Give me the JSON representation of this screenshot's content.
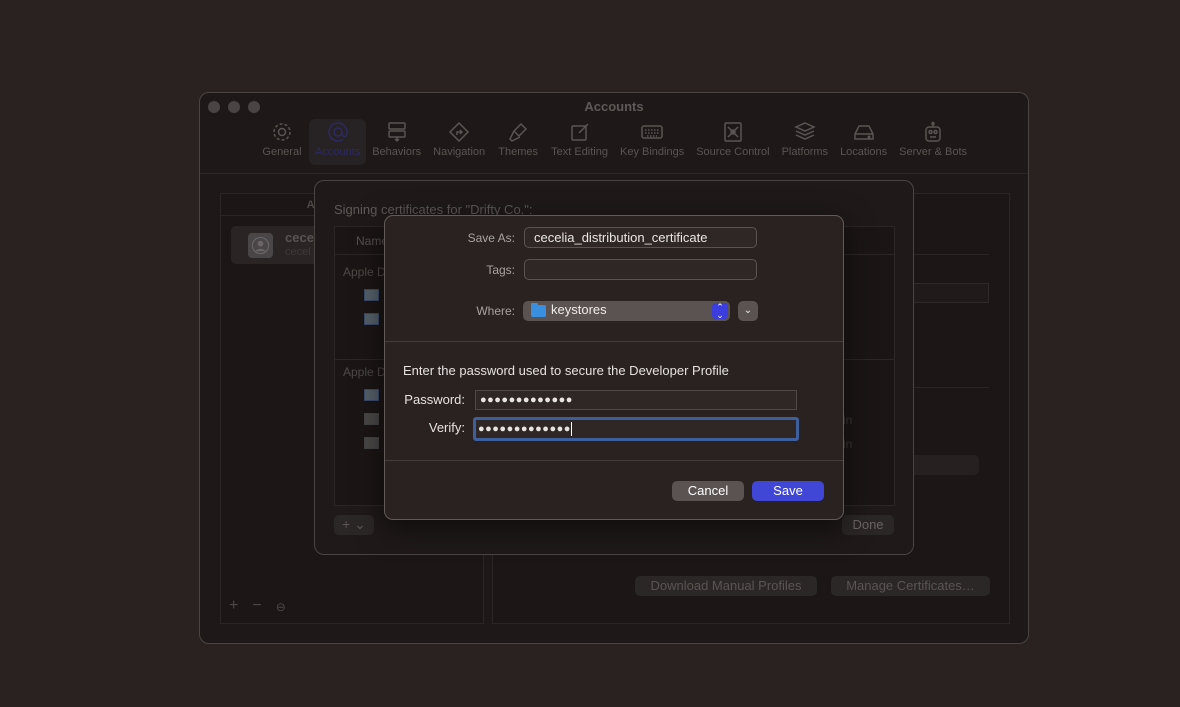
{
  "window": {
    "title": "Accounts",
    "toolbar": [
      {
        "label": "General",
        "icon": "gear-icon",
        "active": false
      },
      {
        "label": "Accounts",
        "icon": "at-icon",
        "active": true
      },
      {
        "label": "Behaviors",
        "icon": "behaviors-icon",
        "active": false
      },
      {
        "label": "Navigation",
        "icon": "navigation-icon",
        "active": false
      },
      {
        "label": "Themes",
        "icon": "paintbrush-icon",
        "active": false
      },
      {
        "label": "Text Editing",
        "icon": "edit-icon",
        "active": false
      },
      {
        "label": "Key Bindings",
        "icon": "keyboard-icon",
        "active": false
      },
      {
        "label": "Source Control",
        "icon": "source-control-icon",
        "active": false
      },
      {
        "label": "Platforms",
        "icon": "layers-icon",
        "active": false
      },
      {
        "label": "Locations",
        "icon": "drive-icon",
        "active": false
      },
      {
        "label": "Server & Bots",
        "icon": "robot-icon",
        "active": false
      }
    ],
    "sidebar": {
      "header": "Apple IDs",
      "account_name": "cece",
      "account_email": "cecel"
    },
    "detail": {
      "download_button": "Download Manual Profiles",
      "manage_button": "Manage Certificates…",
      "ghost_text_1": "in",
      "ghost_text_2": "in"
    }
  },
  "certificates_sheet": {
    "title": "Signing certificates for \"Drifty Co.\":",
    "column_name": "Name",
    "group_1": "Apple D",
    "group_2": "Apple D",
    "add_button": "+ ⌄",
    "done_button": "Done"
  },
  "save_dialog": {
    "save_as_label": "Save As:",
    "save_as_value": "cecelia_distribution_certificate",
    "tags_label": "Tags:",
    "tags_value": "",
    "where_label": "Where:",
    "where_value": "keystores",
    "prompt": "Enter the password used to secure the Developer Profile",
    "password_label": "Password:",
    "password_value": "●●●●●●●●●●●●●",
    "verify_label": "Verify:",
    "verify_value": "●●●●●●●●●●●●●",
    "cancel_button": "Cancel",
    "save_button": "Save",
    "accent_color": "#4046d6",
    "focus_ring_color": "#3d5f9c"
  }
}
